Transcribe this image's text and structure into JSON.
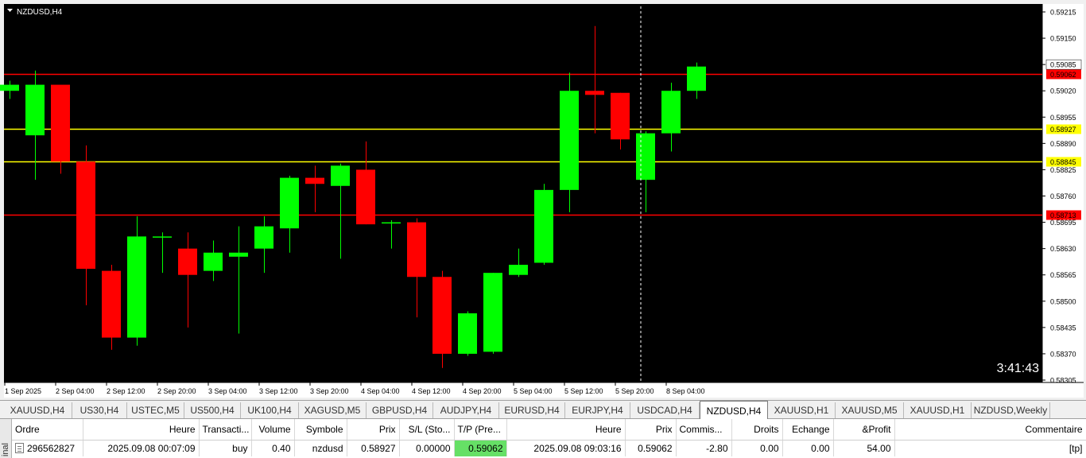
{
  "chart": {
    "symbol_label": "NZDUSD,H4",
    "countdown": "3:41:43",
    "colors": {
      "background": "#000000",
      "bull": "#00ff00",
      "bear": "#ff0000",
      "tp_sl_line": "#ff0000",
      "entry_line": "#ffff00",
      "text": "#ffffff"
    },
    "price_axis": {
      "min": 0.58305,
      "max": 0.59215,
      "ticks": [
        "0.59215",
        "0.59150",
        "0.59085",
        "0.59020",
        "0.58955",
        "0.58890",
        "0.58825",
        "0.58760",
        "0.58695",
        "0.58630",
        "0.58565",
        "0.58500",
        "0.58435",
        "0.58370",
        "0.58305"
      ]
    },
    "time_labels": [
      "1 Sep 2025",
      "2 Sep 04:00",
      "2 Sep 12:00",
      "2 Sep 20:00",
      "3 Sep 04:00",
      "3 Sep 12:00",
      "3 Sep 20:00",
      "4 Sep 04:00",
      "4 Sep 12:00",
      "4 Sep 20:00",
      "5 Sep 04:00",
      "5 Sep 12:00",
      "5 Sep 20:00",
      "8 Sep 04:00"
    ],
    "levels": [
      {
        "price": 0.59062,
        "label": "0.59062",
        "kind": "tp"
      },
      {
        "price": 0.58927,
        "label": "0.58927",
        "kind": "entry"
      },
      {
        "price": 0.58845,
        "label": "0.58845",
        "kind": "entry"
      },
      {
        "price": 0.58713,
        "label": "0.58713",
        "kind": "sl"
      }
    ],
    "bid_label": "0.59085",
    "candles": [
      {
        "o": 0.5902,
        "h": 0.59045,
        "l": 0.59,
        "c": 0.59035
      },
      {
        "o": 0.5891,
        "h": 0.5907,
        "l": 0.588,
        "c": 0.59035
      },
      {
        "o": 0.59035,
        "h": 0.5903,
        "l": 0.58815,
        "c": 0.58845
      },
      {
        "o": 0.58845,
        "h": 0.58885,
        "l": 0.5849,
        "c": 0.5858
      },
      {
        "o": 0.58575,
        "h": 0.5859,
        "l": 0.5838,
        "c": 0.5841
      },
      {
        "o": 0.5841,
        "h": 0.5871,
        "l": 0.5839,
        "c": 0.5866
      },
      {
        "o": 0.5866,
        "h": 0.5867,
        "l": 0.5857,
        "c": 0.5866
      },
      {
        "o": 0.5863,
        "h": 0.5867,
        "l": 0.58435,
        "c": 0.58565
      },
      {
        "o": 0.58575,
        "h": 0.5865,
        "l": 0.5855,
        "c": 0.5862
      },
      {
        "o": 0.5861,
        "h": 0.58685,
        "l": 0.5842,
        "c": 0.5862
      },
      {
        "o": 0.5863,
        "h": 0.5871,
        "l": 0.5857,
        "c": 0.58685
      },
      {
        "o": 0.5868,
        "h": 0.5881,
        "l": 0.5862,
        "c": 0.58805
      },
      {
        "o": 0.58805,
        "h": 0.58835,
        "l": 0.5872,
        "c": 0.5879
      },
      {
        "o": 0.58785,
        "h": 0.5884,
        "l": 0.58605,
        "c": 0.58835
      },
      {
        "o": 0.58825,
        "h": 0.58895,
        "l": 0.5869,
        "c": 0.5869
      },
      {
        "o": 0.58695,
        "h": 0.587,
        "l": 0.5863,
        "c": 0.58695
      },
      {
        "o": 0.58695,
        "h": 0.58705,
        "l": 0.5846,
        "c": 0.5856
      },
      {
        "o": 0.5856,
        "h": 0.58575,
        "l": 0.58335,
        "c": 0.5837
      },
      {
        "o": 0.5837,
        "h": 0.58475,
        "l": 0.58365,
        "c": 0.5847
      },
      {
        "o": 0.58375,
        "h": 0.5857,
        "l": 0.5837,
        "c": 0.5857
      },
      {
        "o": 0.58565,
        "h": 0.5863,
        "l": 0.5856,
        "c": 0.5859
      },
      {
        "o": 0.58595,
        "h": 0.5879,
        "l": 0.5859,
        "c": 0.58775
      },
      {
        "o": 0.58775,
        "h": 0.59065,
        "l": 0.5872,
        "c": 0.5902
      },
      {
        "o": 0.5902,
        "h": 0.5918,
        "l": 0.58915,
        "c": 0.5901
      },
      {
        "o": 0.59015,
        "h": 0.59015,
        "l": 0.58875,
        "c": 0.589
      },
      {
        "o": 0.588,
        "h": 0.5892,
        "l": 0.5872,
        "c": 0.58915
      },
      {
        "o": 0.58915,
        "h": 0.5904,
        "l": 0.5887,
        "c": 0.5902
      },
      {
        "o": 0.5902,
        "h": 0.5909,
        "l": 0.59,
        "c": 0.5908
      }
    ]
  },
  "tabs": [
    {
      "label": "XAUUSD,H4",
      "active": false
    },
    {
      "label": "US30,H4",
      "active": false
    },
    {
      "label": "USTEC,M5",
      "active": false
    },
    {
      "label": "US500,H4",
      "active": false
    },
    {
      "label": "UK100,H4",
      "active": false
    },
    {
      "label": "XAGUSD,M5",
      "active": false
    },
    {
      "label": "GBPUSD,H4",
      "active": false
    },
    {
      "label": "AUDJPY,H4",
      "active": false
    },
    {
      "label": "EURUSD,H4",
      "active": false
    },
    {
      "label": "EURJPY,H4",
      "active": false
    },
    {
      "label": "USDCAD,H4",
      "active": false
    },
    {
      "label": "NZDUSD,H4",
      "active": true
    },
    {
      "label": "XAUUSD,H1",
      "active": false
    },
    {
      "label": "XAUUSD,M5",
      "active": false
    },
    {
      "label": "XAUUSD,H1",
      "active": false
    },
    {
      "label": "NZDUSD,Weekly",
      "active": false
    }
  ],
  "terminal": {
    "side_label": "inal",
    "columns": [
      "Ordre",
      "Heure",
      "Transacti...",
      "Volume",
      "Symbole",
      "Prix",
      "S/L (Sto...",
      "T/P (Pre...",
      "Heure",
      "Prix",
      "Commis...",
      "Droits",
      "Echange",
      "&Profit",
      "Commentaire"
    ],
    "row": {
      "order": "296562827",
      "time_open": "2025.09.08 00:07:09",
      "type": "buy",
      "volume": "0.40",
      "symbol": "nzdusd",
      "price_open": "0.58927",
      "sl": "0.00000",
      "tp": "0.59062",
      "time_now": "2025.09.08 09:03:16",
      "price_now": "0.59062",
      "commission": "-2.80",
      "rights": "0.00",
      "swap": "0.00",
      "profit": "54.00",
      "comment": "[tp]"
    }
  }
}
